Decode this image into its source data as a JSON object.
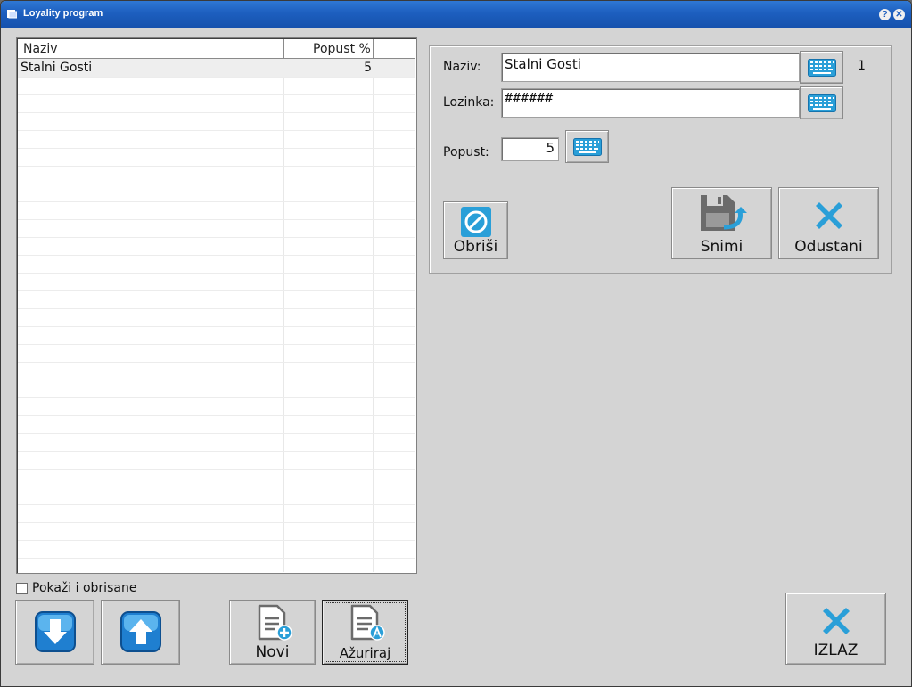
{
  "window": {
    "title": "Loyality program"
  },
  "grid": {
    "columns": [
      "Naziv",
      "Popust %"
    ],
    "rows": [
      {
        "naziv": "Stalni Gosti",
        "popust": "5"
      }
    ]
  },
  "show_deleted_label": "Pokaži i obrisane",
  "bottom": {
    "new_label": "Novi",
    "update_label": "Ažuriraj",
    "exit_label": "IZLAZ"
  },
  "form": {
    "name_label": "Naziv:",
    "name_value": "Stalni Gosti",
    "password_label": "Lozinka:",
    "password_value": "######",
    "discount_label": "Popust:",
    "discount_value": "5",
    "record_id": "1",
    "delete_label": "Obriši",
    "save_label": "Snimi",
    "cancel_label": "Odustani"
  },
  "colors": {
    "titlebar": "#1d5fbf",
    "accent": "#2a9fd8",
    "dialog_bg": "#d4d4d4"
  }
}
